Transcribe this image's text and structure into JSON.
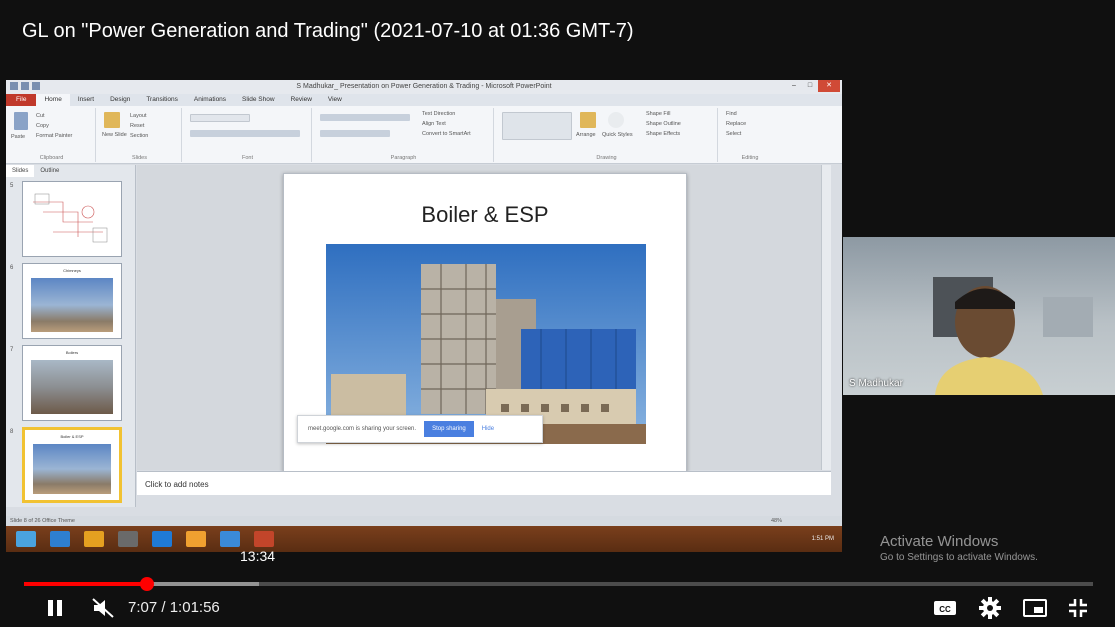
{
  "video": {
    "title": "GL on \"Power Generation and Trading\" (2021-07-10 at 01:36 GMT-7)",
    "progress_fraction": 0.1147,
    "loaded_fraction": 0.22,
    "scrub_preview_time": "13:34",
    "current_time": "7:07",
    "duration": "1:01:56",
    "time_separator": " / ",
    "accent_color": "#ff0000"
  },
  "ppt": {
    "window_title": "S Madhukar_ Presentation on Power Generation & Trading - Microsoft PowerPoint",
    "tabs": [
      "File",
      "Home",
      "Insert",
      "Design",
      "Transitions",
      "Animations",
      "Slide Show",
      "Review",
      "View"
    ],
    "ribbon_groups": [
      "Clipboard",
      "Slides",
      "Font",
      "Paragraph",
      "Drawing",
      "Editing"
    ],
    "ribbon_buttons": {
      "paste": "Paste",
      "cut": "Cut",
      "copy": "Copy",
      "format_painter": "Format Painter",
      "new_slide": "New Slide",
      "layout": "Layout",
      "reset": "Reset",
      "section": "Section",
      "text_direction": "Text Direction",
      "align_text": "Align Text",
      "convert_smartart": "Convert to SmartArt",
      "arrange": "Arrange",
      "quick_styles": "Quick Styles",
      "shape_fill": "Shape Fill",
      "shape_outline": "Shape Outline",
      "shape_effects": "Shape Effects",
      "find": "Find",
      "replace": "Replace",
      "select": "Select"
    },
    "panel_tabs": [
      "Slides",
      "Outline"
    ],
    "thumbnails": [
      {
        "number": "5",
        "title": ""
      },
      {
        "number": "6",
        "title": "Chimneys"
      },
      {
        "number": "7",
        "title": "Boilers"
      },
      {
        "number": "8",
        "title": "Boiler & ESP"
      }
    ],
    "slide_title": "Boiler & ESP",
    "notes_placeholder": "Click to add notes",
    "status_left": "Slide 8 of 26   Office Theme",
    "zoom": "48%",
    "share_banner_text": "meet.google.com is sharing your screen.",
    "share_banner_stop": "Stop sharing",
    "share_banner_hide": "Hide"
  },
  "taskbar": {
    "clock": "1:51 PM"
  },
  "camera": {
    "participant_name": "S Madhukar"
  },
  "watermark": {
    "line1": "Activate Windows",
    "line2": "Go to Settings to activate Windows."
  }
}
